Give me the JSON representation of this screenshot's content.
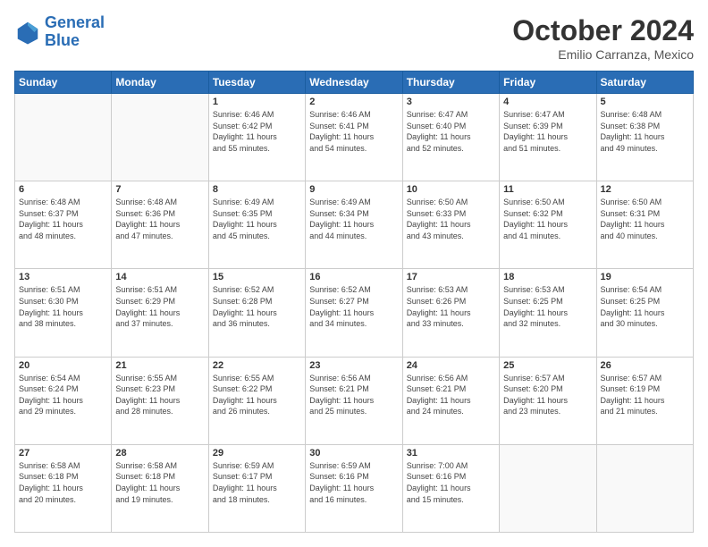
{
  "header": {
    "logo_line1": "General",
    "logo_line2": "Blue",
    "month_title": "October 2024",
    "subtitle": "Emilio Carranza, Mexico"
  },
  "weekdays": [
    "Sunday",
    "Monday",
    "Tuesday",
    "Wednesday",
    "Thursday",
    "Friday",
    "Saturday"
  ],
  "weeks": [
    [
      {
        "day": "",
        "info": ""
      },
      {
        "day": "",
        "info": ""
      },
      {
        "day": "1",
        "info": "Sunrise: 6:46 AM\nSunset: 6:42 PM\nDaylight: 11 hours\nand 55 minutes."
      },
      {
        "day": "2",
        "info": "Sunrise: 6:46 AM\nSunset: 6:41 PM\nDaylight: 11 hours\nand 54 minutes."
      },
      {
        "day": "3",
        "info": "Sunrise: 6:47 AM\nSunset: 6:40 PM\nDaylight: 11 hours\nand 52 minutes."
      },
      {
        "day": "4",
        "info": "Sunrise: 6:47 AM\nSunset: 6:39 PM\nDaylight: 11 hours\nand 51 minutes."
      },
      {
        "day": "5",
        "info": "Sunrise: 6:48 AM\nSunset: 6:38 PM\nDaylight: 11 hours\nand 49 minutes."
      }
    ],
    [
      {
        "day": "6",
        "info": "Sunrise: 6:48 AM\nSunset: 6:37 PM\nDaylight: 11 hours\nand 48 minutes."
      },
      {
        "day": "7",
        "info": "Sunrise: 6:48 AM\nSunset: 6:36 PM\nDaylight: 11 hours\nand 47 minutes."
      },
      {
        "day": "8",
        "info": "Sunrise: 6:49 AM\nSunset: 6:35 PM\nDaylight: 11 hours\nand 45 minutes."
      },
      {
        "day": "9",
        "info": "Sunrise: 6:49 AM\nSunset: 6:34 PM\nDaylight: 11 hours\nand 44 minutes."
      },
      {
        "day": "10",
        "info": "Sunrise: 6:50 AM\nSunset: 6:33 PM\nDaylight: 11 hours\nand 43 minutes."
      },
      {
        "day": "11",
        "info": "Sunrise: 6:50 AM\nSunset: 6:32 PM\nDaylight: 11 hours\nand 41 minutes."
      },
      {
        "day": "12",
        "info": "Sunrise: 6:50 AM\nSunset: 6:31 PM\nDaylight: 11 hours\nand 40 minutes."
      }
    ],
    [
      {
        "day": "13",
        "info": "Sunrise: 6:51 AM\nSunset: 6:30 PM\nDaylight: 11 hours\nand 38 minutes."
      },
      {
        "day": "14",
        "info": "Sunrise: 6:51 AM\nSunset: 6:29 PM\nDaylight: 11 hours\nand 37 minutes."
      },
      {
        "day": "15",
        "info": "Sunrise: 6:52 AM\nSunset: 6:28 PM\nDaylight: 11 hours\nand 36 minutes."
      },
      {
        "day": "16",
        "info": "Sunrise: 6:52 AM\nSunset: 6:27 PM\nDaylight: 11 hours\nand 34 minutes."
      },
      {
        "day": "17",
        "info": "Sunrise: 6:53 AM\nSunset: 6:26 PM\nDaylight: 11 hours\nand 33 minutes."
      },
      {
        "day": "18",
        "info": "Sunrise: 6:53 AM\nSunset: 6:25 PM\nDaylight: 11 hours\nand 32 minutes."
      },
      {
        "day": "19",
        "info": "Sunrise: 6:54 AM\nSunset: 6:25 PM\nDaylight: 11 hours\nand 30 minutes."
      }
    ],
    [
      {
        "day": "20",
        "info": "Sunrise: 6:54 AM\nSunset: 6:24 PM\nDaylight: 11 hours\nand 29 minutes."
      },
      {
        "day": "21",
        "info": "Sunrise: 6:55 AM\nSunset: 6:23 PM\nDaylight: 11 hours\nand 28 minutes."
      },
      {
        "day": "22",
        "info": "Sunrise: 6:55 AM\nSunset: 6:22 PM\nDaylight: 11 hours\nand 26 minutes."
      },
      {
        "day": "23",
        "info": "Sunrise: 6:56 AM\nSunset: 6:21 PM\nDaylight: 11 hours\nand 25 minutes."
      },
      {
        "day": "24",
        "info": "Sunrise: 6:56 AM\nSunset: 6:21 PM\nDaylight: 11 hours\nand 24 minutes."
      },
      {
        "day": "25",
        "info": "Sunrise: 6:57 AM\nSunset: 6:20 PM\nDaylight: 11 hours\nand 23 minutes."
      },
      {
        "day": "26",
        "info": "Sunrise: 6:57 AM\nSunset: 6:19 PM\nDaylight: 11 hours\nand 21 minutes."
      }
    ],
    [
      {
        "day": "27",
        "info": "Sunrise: 6:58 AM\nSunset: 6:18 PM\nDaylight: 11 hours\nand 20 minutes."
      },
      {
        "day": "28",
        "info": "Sunrise: 6:58 AM\nSunset: 6:18 PM\nDaylight: 11 hours\nand 19 minutes."
      },
      {
        "day": "29",
        "info": "Sunrise: 6:59 AM\nSunset: 6:17 PM\nDaylight: 11 hours\nand 18 minutes."
      },
      {
        "day": "30",
        "info": "Sunrise: 6:59 AM\nSunset: 6:16 PM\nDaylight: 11 hours\nand 16 minutes."
      },
      {
        "day": "31",
        "info": "Sunrise: 7:00 AM\nSunset: 6:16 PM\nDaylight: 11 hours\nand 15 minutes."
      },
      {
        "day": "",
        "info": ""
      },
      {
        "day": "",
        "info": ""
      }
    ]
  ]
}
